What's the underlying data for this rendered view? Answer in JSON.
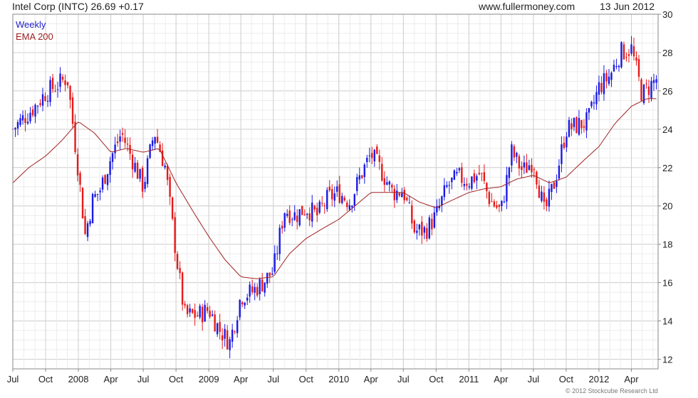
{
  "header": {
    "title": "Intel Corp (INTC) 26.69 +0.17",
    "site": "www.fullermoney.com",
    "date": "13 Jun 2012"
  },
  "legend": {
    "weekly": "Weekly",
    "ema": "EMA 200"
  },
  "footer": {
    "copyright": "© 2012 Stockcube Research Ltd"
  },
  "colors": {
    "up": "#1a1ae6",
    "down": "#e61a1a",
    "ema": "#a02020",
    "grid": "#cfcfcf",
    "frame": "#888888"
  },
  "chart_data": {
    "type": "candlestick",
    "frequency": "weekly",
    "y_ticks": [
      12,
      14,
      16,
      18,
      20,
      22,
      24,
      26,
      28,
      30
    ],
    "ylim": [
      11.5,
      30
    ],
    "x_ticks": [
      "Jul",
      "Oct",
      "2008",
      "Apr",
      "Jul",
      "Oct",
      "2009",
      "Apr",
      "Jul",
      "Oct",
      "2010",
      "Apr",
      "Jul",
      "Oct",
      "2011",
      "Apr",
      "Jul",
      "Oct",
      "2012",
      "Apr"
    ],
    "x_range": [
      "2007-07-01",
      "2012-06-15"
    ],
    "grid": true,
    "y_axis_side": "right",
    "close_path": [
      [
        "2007-07-01",
        24.0
      ],
      [
        "2007-08-01",
        24.6
      ],
      [
        "2007-09-01",
        25.2
      ],
      [
        "2007-10-01",
        25.9
      ],
      [
        "2007-11-01",
        26.3
      ],
      [
        "2007-12-01",
        26.7
      ],
      [
        "2008-01-01",
        21.8
      ],
      [
        "2008-01-20",
        18.5
      ],
      [
        "2008-02-10",
        20.3
      ],
      [
        "2008-03-01",
        20.8
      ],
      [
        "2008-04-01",
        22.5
      ],
      [
        "2008-05-01",
        23.8
      ],
      [
        "2008-06-01",
        22.4
      ],
      [
        "2008-07-01",
        21.0
      ],
      [
        "2008-08-01",
        23.9
      ],
      [
        "2008-09-01",
        22.0
      ],
      [
        "2008-10-01",
        17.5
      ],
      [
        "2008-10-25",
        14.3
      ],
      [
        "2008-12-01",
        14.3
      ],
      [
        "2009-01-01",
        14.6
      ],
      [
        "2009-02-01",
        13.5
      ],
      [
        "2009-03-01",
        12.9
      ],
      [
        "2009-04-01",
        15.3
      ],
      [
        "2009-05-01",
        15.5
      ],
      [
        "2009-06-01",
        16.0
      ],
      [
        "2009-07-01",
        16.6
      ],
      [
        "2009-08-01",
        19.8
      ],
      [
        "2009-09-01",
        19.5
      ],
      [
        "2009-10-01",
        19.9
      ],
      [
        "2009-11-01",
        19.5
      ],
      [
        "2009-12-01",
        20.4
      ],
      [
        "2010-01-01",
        20.7
      ],
      [
        "2010-02-01",
        20.2
      ],
      [
        "2010-03-01",
        21.5
      ],
      [
        "2010-04-01",
        22.7
      ],
      [
        "2010-05-01",
        21.8
      ],
      [
        "2010-06-01",
        20.7
      ],
      [
        "2010-07-01",
        20.8
      ],
      [
        "2010-08-01",
        18.7
      ],
      [
        "2010-09-01",
        18.7
      ],
      [
        "2010-10-01",
        19.5
      ],
      [
        "2010-11-01",
        21.0
      ],
      [
        "2010-12-01",
        21.5
      ],
      [
        "2011-01-01",
        21.3
      ],
      [
        "2011-02-01",
        21.7
      ],
      [
        "2011-03-01",
        20.3
      ],
      [
        "2011-04-01",
        19.7
      ],
      [
        "2011-05-01",
        22.8
      ],
      [
        "2011-06-01",
        21.8
      ],
      [
        "2011-07-01",
        22.4
      ],
      [
        "2011-08-01",
        19.6
      ],
      [
        "2011-09-01",
        21.4
      ],
      [
        "2011-10-01",
        24.0
      ],
      [
        "2011-11-01",
        24.2
      ],
      [
        "2011-12-01",
        24.4
      ],
      [
        "2012-01-01",
        26.2
      ],
      [
        "2012-02-01",
        26.8
      ],
      [
        "2012-03-01",
        28.0
      ],
      [
        "2012-04-01",
        28.2
      ],
      [
        "2012-05-01",
        25.8
      ],
      [
        "2012-06-13",
        26.69
      ]
    ],
    "ema_200": [
      [
        "2007-07-01",
        21.2
      ],
      [
        "2007-08-15",
        22.0
      ],
      [
        "2007-10-01",
        22.6
      ],
      [
        "2007-11-15",
        23.4
      ],
      [
        "2008-01-01",
        24.4
      ],
      [
        "2008-02-15",
        23.8
      ],
      [
        "2008-04-01",
        22.8
      ],
      [
        "2008-05-15",
        23.0
      ],
      [
        "2008-07-01",
        22.8
      ],
      [
        "2008-08-15",
        23.0
      ],
      [
        "2008-10-01",
        21.2
      ],
      [
        "2008-11-15",
        19.8
      ],
      [
        "2009-01-01",
        18.4
      ],
      [
        "2009-02-15",
        17.2
      ],
      [
        "2009-04-01",
        16.3
      ],
      [
        "2009-05-15",
        16.2
      ],
      [
        "2009-07-01",
        16.3
      ],
      [
        "2009-08-15",
        17.5
      ],
      [
        "2009-10-01",
        18.3
      ],
      [
        "2009-11-15",
        18.8
      ],
      [
        "2010-01-01",
        19.3
      ],
      [
        "2010-02-15",
        20.0
      ],
      [
        "2010-04-01",
        20.7
      ],
      [
        "2010-05-15",
        20.7
      ],
      [
        "2010-07-01",
        20.7
      ],
      [
        "2010-08-15",
        20.2
      ],
      [
        "2010-10-01",
        19.9
      ],
      [
        "2010-11-15",
        20.3
      ],
      [
        "2011-01-01",
        20.7
      ],
      [
        "2011-02-15",
        20.9
      ],
      [
        "2011-04-01",
        21.0
      ],
      [
        "2011-05-15",
        21.4
      ],
      [
        "2011-07-01",
        21.6
      ],
      [
        "2011-08-15",
        21.2
      ],
      [
        "2011-10-01",
        21.5
      ],
      [
        "2011-11-15",
        22.3
      ],
      [
        "2012-01-01",
        23.1
      ],
      [
        "2012-02-15",
        24.3
      ],
      [
        "2012-04-01",
        25.2
      ],
      [
        "2012-05-15",
        25.6
      ],
      [
        "2012-06-13",
        25.6
      ]
    ]
  }
}
